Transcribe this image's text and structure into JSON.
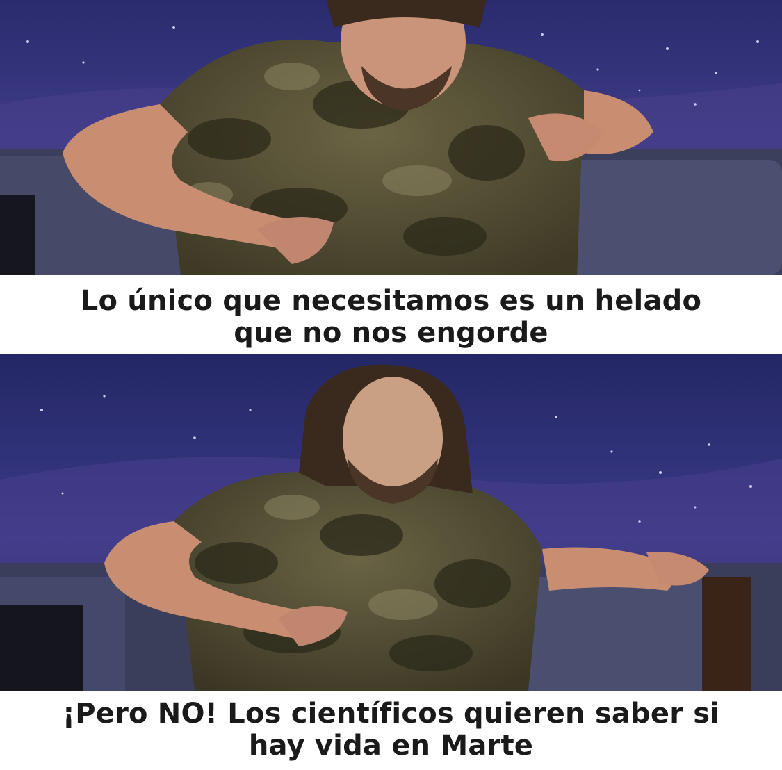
{
  "meme": {
    "panels": [
      {
        "caption_lines": [
          "Lo único que necesitamos es un helado",
          "que no nos engorde"
        ]
      },
      {
        "caption_lines": [
          "¡Pero NO! Los científicos quieren saber si",
          "hay vida en Marte"
        ]
      }
    ]
  }
}
